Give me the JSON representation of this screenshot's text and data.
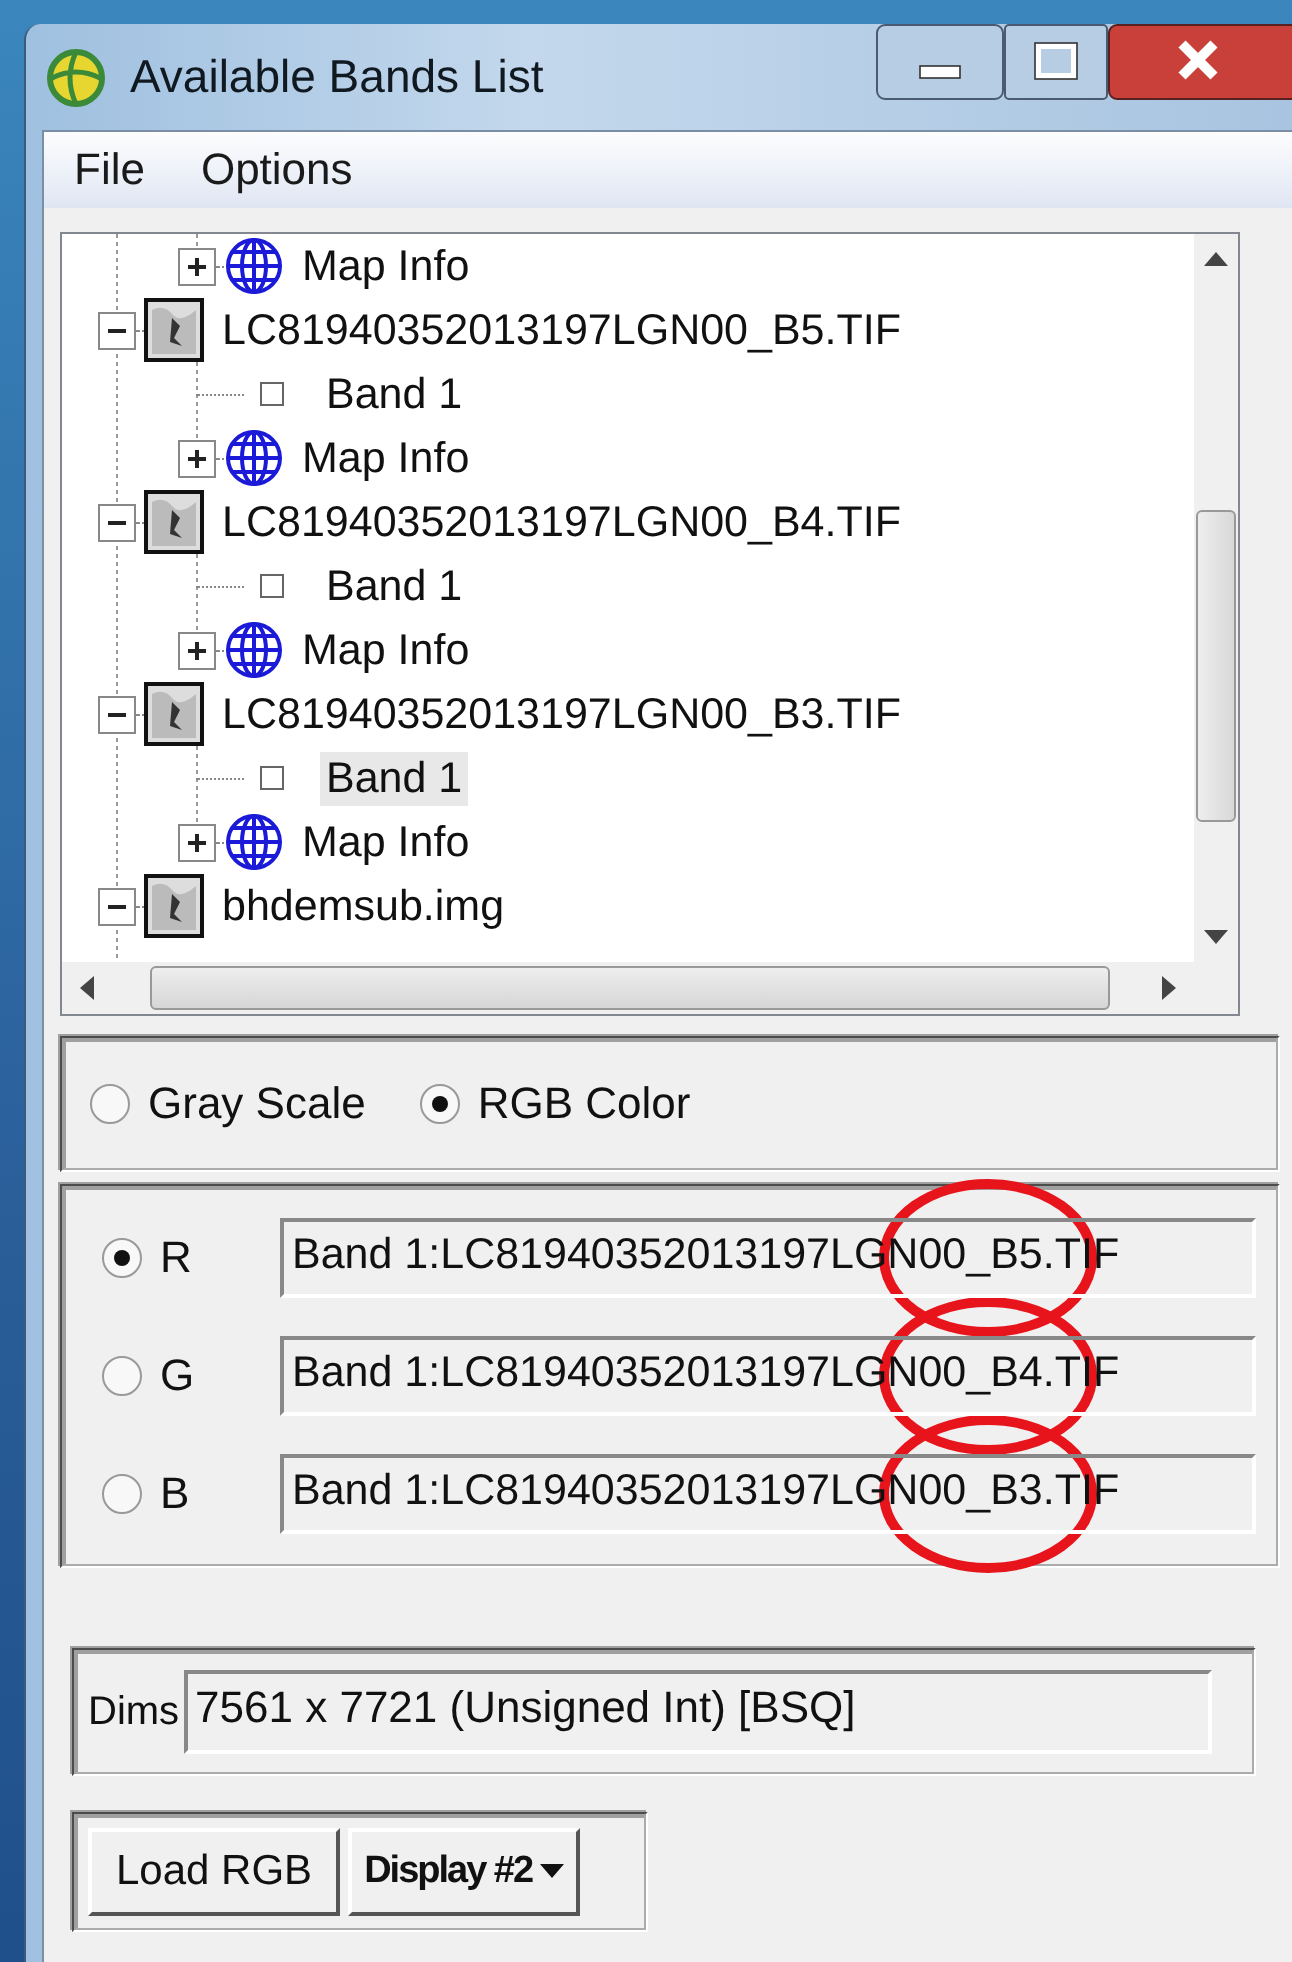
{
  "window": {
    "title": "Available Bands List"
  },
  "menu": [
    {
      "label": "File"
    },
    {
      "label": "Options"
    }
  ],
  "tree": {
    "hidden_parent_children": [
      {
        "kind": "map-info",
        "label": "Map Info",
        "expanded": false
      }
    ],
    "files": [
      {
        "label": "LC81940352013197LGN00_B5.TIF",
        "expanded": true,
        "children": [
          {
            "kind": "band",
            "label": "Band 1",
            "selected": false
          },
          {
            "kind": "map-info",
            "label": "Map Info",
            "expanded": false
          }
        ]
      },
      {
        "label": "LC81940352013197LGN00_B4.TIF",
        "expanded": true,
        "children": [
          {
            "kind": "band",
            "label": "Band 1",
            "selected": false
          },
          {
            "kind": "map-info",
            "label": "Map Info",
            "expanded": false
          }
        ]
      },
      {
        "label": "LC81940352013197LGN00_B3.TIF",
        "expanded": true,
        "children": [
          {
            "kind": "band",
            "label": "Band 1",
            "selected": true
          },
          {
            "kind": "map-info",
            "label": "Map Info",
            "expanded": false
          }
        ]
      },
      {
        "label": "bhdemsub.img",
        "expanded": true
      }
    ]
  },
  "color_modes": [
    {
      "label": "Gray Scale",
      "selected": false
    },
    {
      "label": "RGB Color",
      "selected": true
    }
  ],
  "channels": [
    {
      "label": "R",
      "selected": true,
      "value": "Band 1:LC81940352013197LGN00_B5.TIF",
      "circled": true
    },
    {
      "label": "G",
      "selected": false,
      "value": "Band 1:LC81940352013197LGN00_B4.TIF",
      "circled": true
    },
    {
      "label": "B",
      "selected": false,
      "value": "Band 1:LC81940352013197LGN00_B3.TIF",
      "circled": true
    }
  ],
  "dims": {
    "label": "Dims",
    "value": "7561 x 7721 (Unsigned Int) [BSQ]"
  },
  "buttons": [
    {
      "kind": "button",
      "label": "Load RGB"
    },
    {
      "kind": "dropdown",
      "label": "Display #2"
    }
  ]
}
